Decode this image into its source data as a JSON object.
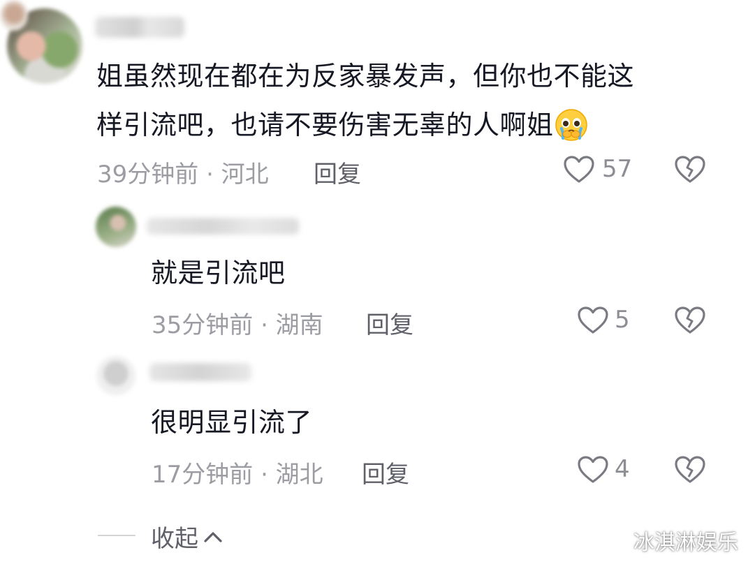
{
  "comments": [
    {
      "text_line1": "姐虽然现在都在为反家暴发声，但你也不能这",
      "text_line2": "样引流吧，也请不要伤害无辜的人啊姐",
      "emoji": "pleading-crying-face",
      "time_location": "39分钟前 · 河北",
      "reply_label": "回复",
      "like_count": "57"
    }
  ],
  "replies": [
    {
      "text": "就是引流吧",
      "time_location": "35分钟前 · 湖南",
      "reply_label": "回复",
      "like_count": "5"
    },
    {
      "text": "很明显引流了",
      "time_location": "17分钟前 · 湖北",
      "reply_label": "回复",
      "like_count": "4"
    }
  ],
  "collapse_label": "收起",
  "watermark": "冰淇淋娱乐",
  "icons": {
    "like": "heart-outline-icon",
    "dislike": "broken-heart-icon",
    "collapse": "chevron-up-icon"
  },
  "colors": {
    "text": "#161823",
    "meta": "#9c9da3",
    "action": "#5f6068"
  }
}
